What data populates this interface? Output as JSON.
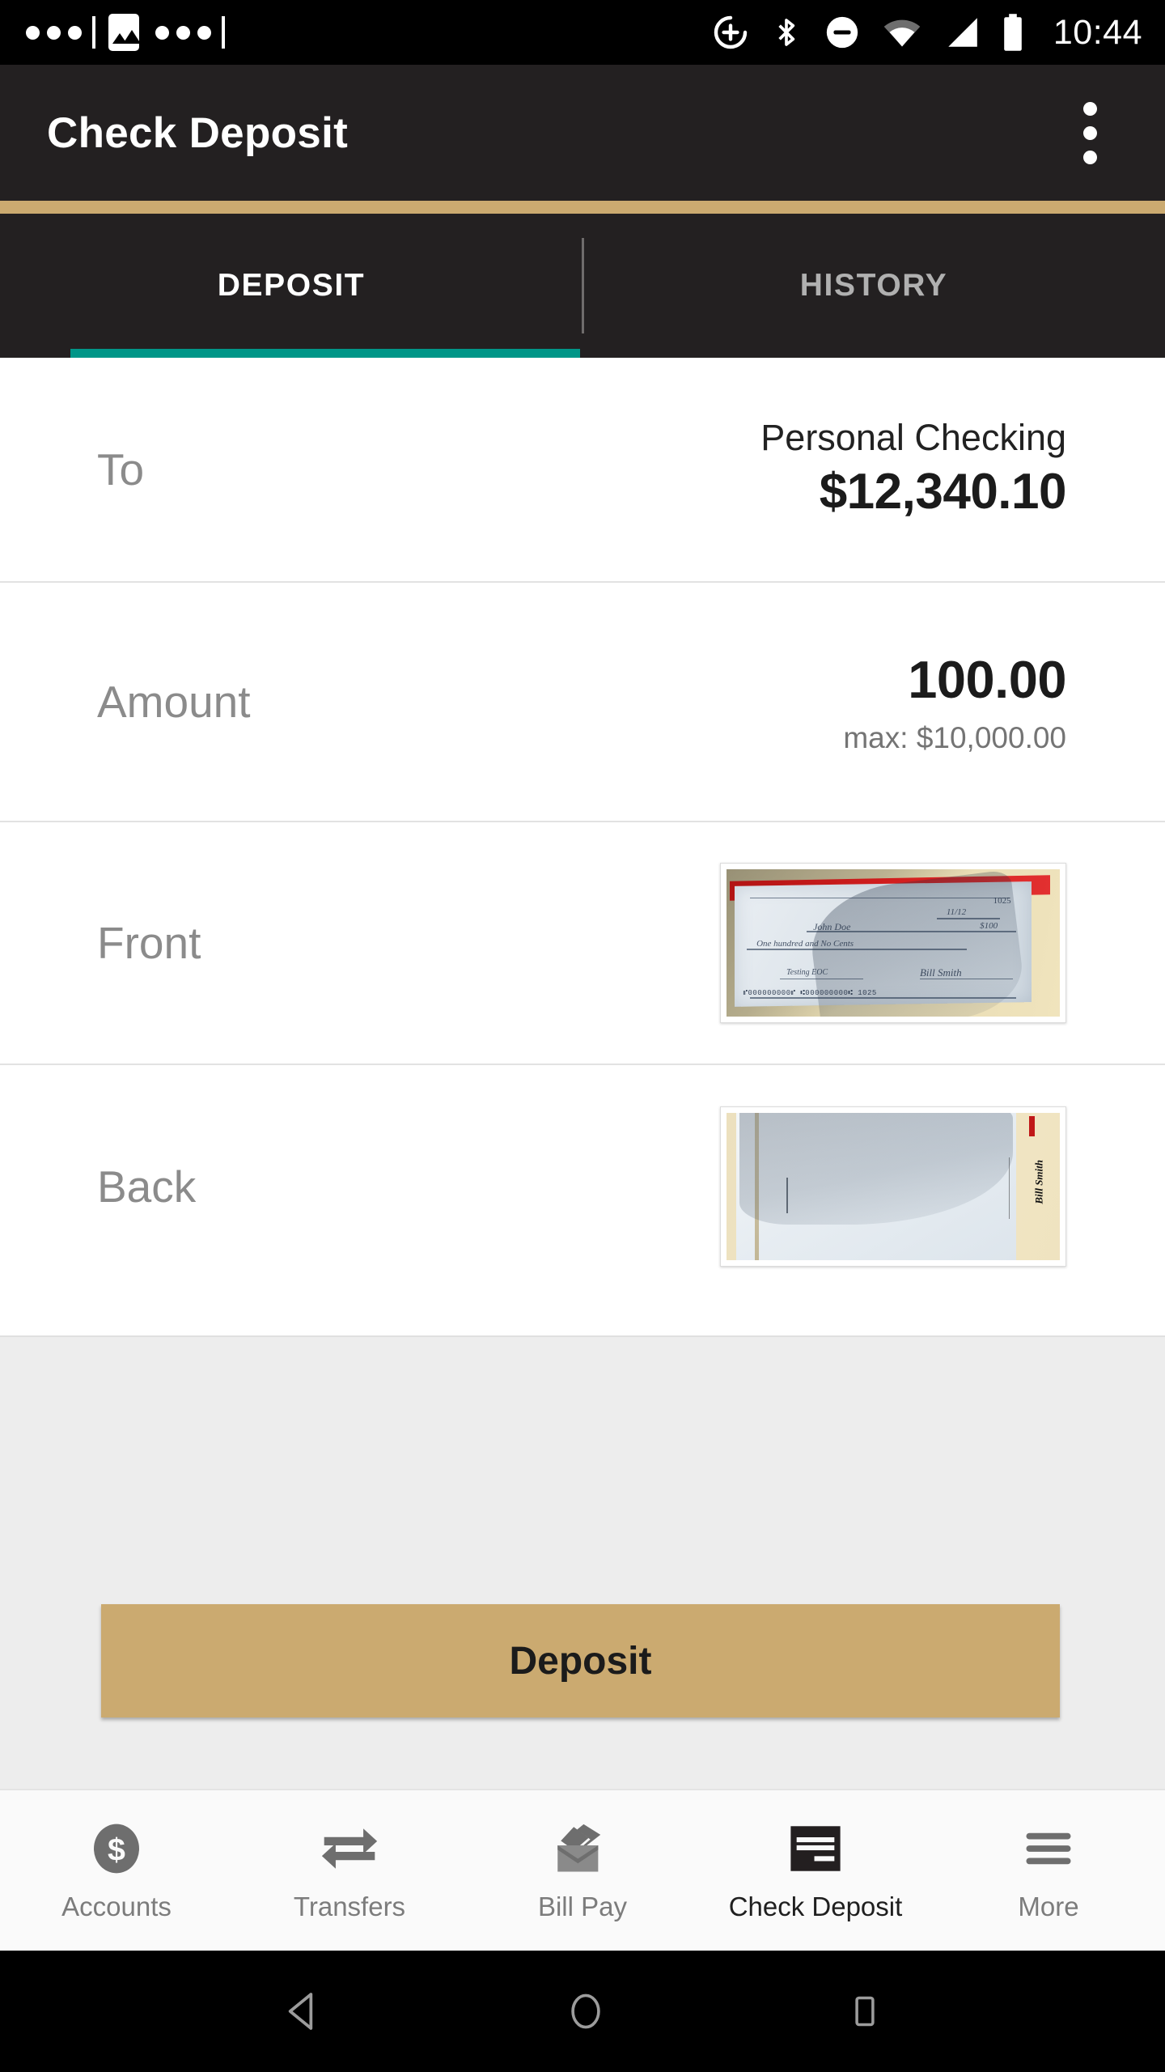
{
  "status_bar": {
    "time": "10:44",
    "icons": [
      "more-notifications-icon",
      "image-notification-icon",
      "more-notifications-icon",
      "sync-icon",
      "bluetooth-icon",
      "do-not-disturb-icon",
      "wifi-icon",
      "cell-signal-icon",
      "battery-icon"
    ]
  },
  "app_bar": {
    "title": "Check Deposit",
    "overflow_label": "More options"
  },
  "theme": {
    "accent": "#cbaa70",
    "appbar_bg": "#232021",
    "tab_indicator": "#009688",
    "panel_bg": "#ededed"
  },
  "tabs": [
    {
      "label": "DEPOSIT",
      "active": true
    },
    {
      "label": "HISTORY",
      "active": false
    }
  ],
  "form": {
    "to": {
      "label": "To",
      "account_name": "Personal Checking",
      "account_balance": "$12,340.10"
    },
    "amount": {
      "label": "Amount",
      "value": "100.00",
      "max_hint": "max: $10,000.00"
    },
    "front": {
      "label": "Front",
      "thumbnail_alt": "check-front-photo"
    },
    "back": {
      "label": "Back",
      "thumbnail_alt": "check-back-photo"
    }
  },
  "check_front_text": {
    "date": "11/12/2013",
    "pay_to": "John Doe",
    "amount_numeric": "$ 100.00",
    "amount_words": "One hundred and No Cents",
    "memo": "Testing EOC",
    "signature": "Bill Smith",
    "check_number": "1025",
    "micr": "1:000000000001: 1000000000001:  1025"
  },
  "check_back_text": {
    "endorsement": "Bill Smith"
  },
  "primary_action": {
    "label": "Deposit"
  },
  "bottom_nav": [
    {
      "label": "Accounts",
      "icon": "dollar-circle-icon",
      "active": false
    },
    {
      "label": "Transfers",
      "icon": "transfer-arrows-icon",
      "active": false
    },
    {
      "label": "Bill Pay",
      "icon": "envelope-pen-icon",
      "active": false
    },
    {
      "label": "Check Deposit",
      "icon": "check-document-icon",
      "active": true
    },
    {
      "label": "More",
      "icon": "hamburger-menu-icon",
      "active": false
    }
  ],
  "system_nav": [
    {
      "label": "Back",
      "icon": "back-triangle-icon"
    },
    {
      "label": "Home",
      "icon": "home-circle-icon"
    },
    {
      "label": "Recents",
      "icon": "recents-square-icon"
    }
  ]
}
